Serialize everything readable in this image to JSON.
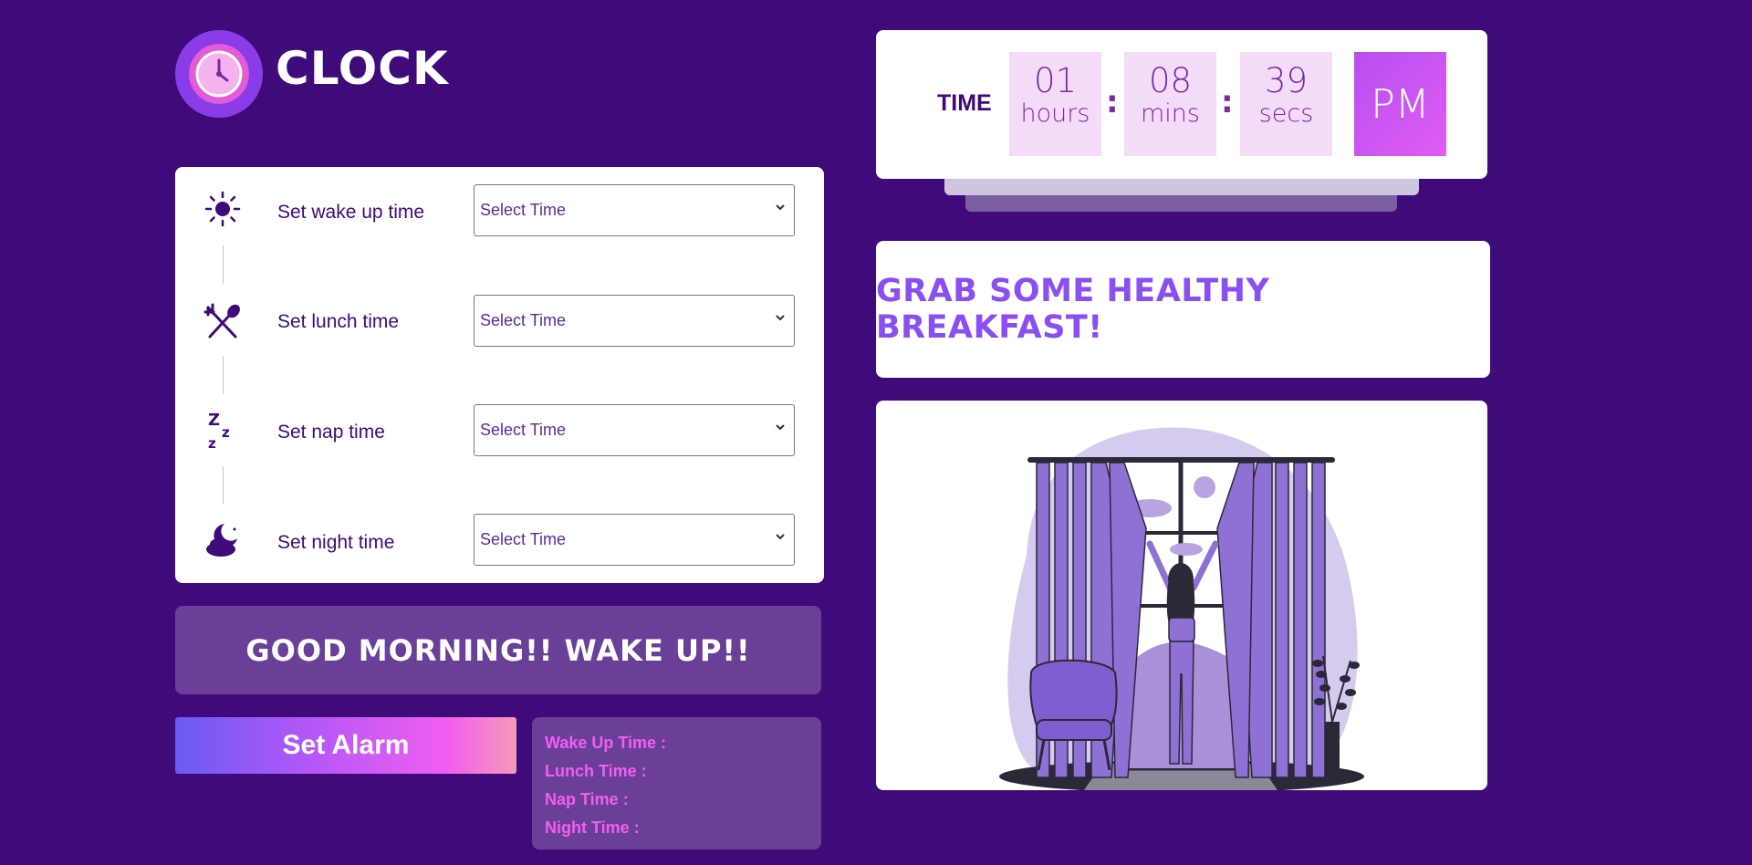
{
  "app": {
    "logo_text": "CLOCK"
  },
  "alarms": {
    "rows": [
      {
        "icon": "sun-icon",
        "label": "Set wake up time",
        "select_value": "Select Time"
      },
      {
        "icon": "fork-spoon-icon",
        "label": "Set lunch time",
        "select_value": "Select Time"
      },
      {
        "icon": "zzz-icon",
        "label": "Set nap time",
        "select_value": "Select Time"
      },
      {
        "icon": "moon-cloud-icon",
        "label": "Set night time",
        "select_value": "Select Time"
      }
    ]
  },
  "message": "GOOD MORNING!! WAKE UP!!",
  "set_alarm_label": "Set Alarm",
  "summary": {
    "wake": "Wake Up Time :",
    "lunch": "Lunch Time :",
    "nap": "Nap Time :",
    "night": "Night Time :"
  },
  "time": {
    "label": "TIME",
    "hours": "01",
    "hours_unit": "hours",
    "mins": "08",
    "mins_unit": "mins",
    "secs": "39",
    "secs_unit": "secs",
    "ampm": "PM",
    "separator": ":"
  },
  "banner": "GRAB SOME HEALTHY BREAKFAST!",
  "colors": {
    "background": "#3f0a79",
    "accent": "#f25ef0",
    "banner_text": "#8a4ff2"
  }
}
